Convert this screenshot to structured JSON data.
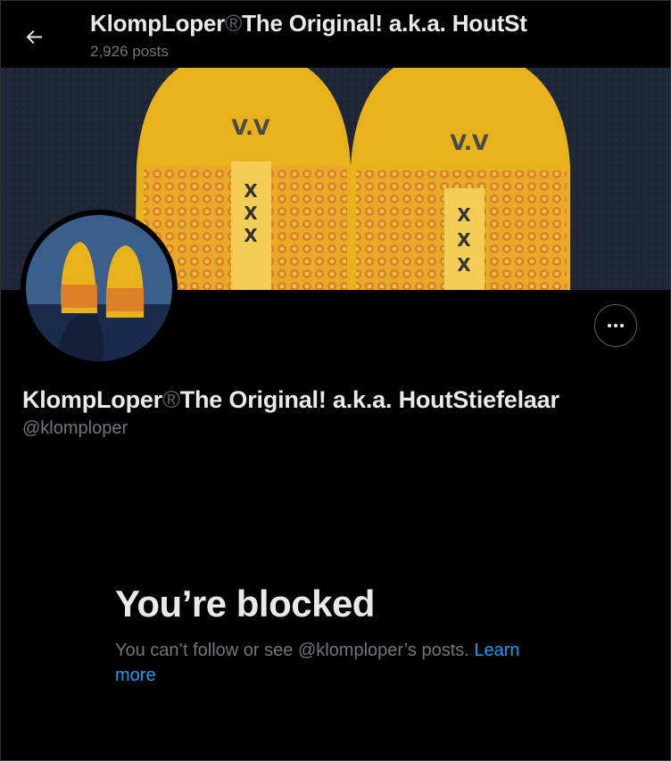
{
  "header": {
    "title_part1": "KlompLoper",
    "title_reg": "®",
    "title_part2": "The Original! a.k.a. HoutSt",
    "post_count": "2,926 posts"
  },
  "profile": {
    "name_part1": "KlompLoper",
    "name_reg": "®",
    "name_part2": "The Original! a.k.a. HoutStiefelaar",
    "handle": "@klomploper"
  },
  "blocked": {
    "title": "You’re blocked",
    "message": "You can’t follow or see @klomploper’s posts.",
    "link_text": "Learn more"
  },
  "icons": {
    "back": "arrow-left-icon",
    "more": "more-horizontal-icon"
  },
  "colors": {
    "background": "#000000",
    "text_primary": "#e7e9ea",
    "text_secondary": "#71767b",
    "link": "#1d9bf0",
    "clog_yellow": "#e8b21c"
  }
}
